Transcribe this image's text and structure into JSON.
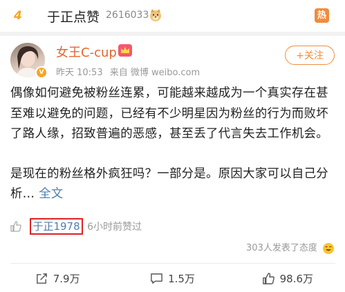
{
  "trending": {
    "rank": "4",
    "title": "于正点赞",
    "count": "2616033",
    "hot_label": "热",
    "icons": {
      "dog": "doge-emoji-icon",
      "hot": "hot-badge-icon"
    }
  },
  "post": {
    "username": "女王C-cup",
    "time": "昨天 10:53",
    "source": "来自 微博 weibo.com",
    "follow_label": "+关注",
    "paragraph1": "偶像如何避免被粉丝连累，可能越来越成为一个真实存在甚至难以避免的问题，已经有不少明星因为粉丝的行为而败坏了路人缘，招致普遍的恶感，甚至丢了代言失去工作机会。",
    "paragraph2": "是现在的粉丝格外疯狂吗？一部分是。原因大家可以自己分析...",
    "full_text_label": "全文",
    "liked_by": "于正1978",
    "liked_time": "6小时前赞过",
    "attitude_text": "303人发表了态度"
  },
  "actions": [
    {
      "icon": "share-icon",
      "label": "7.9万"
    },
    {
      "icon": "comment-icon",
      "label": "1.5万"
    },
    {
      "icon": "thumbs-up-icon",
      "label": "98.6万"
    }
  ],
  "colors": {
    "accent": "#f28b3a",
    "username": "#e8642c",
    "link": "#507daf",
    "highlight_box": "#e02020"
  }
}
